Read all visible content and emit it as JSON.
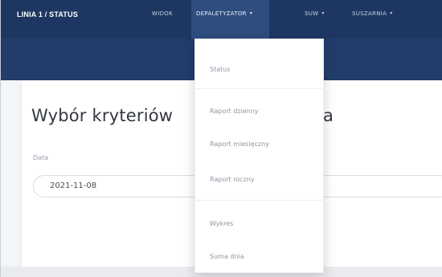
{
  "navbar": {
    "brand": "LINIA 1 / STATUS",
    "items": [
      {
        "label": "WIDOK",
        "caret": ""
      },
      {
        "label": "DEPALETYZATOR",
        "caret": "▾"
      },
      {
        "label": "SUW",
        "caret": "▾"
      },
      {
        "label": "SUSZARNIA",
        "caret": "▾"
      }
    ]
  },
  "dropdown": {
    "items": [
      "Status",
      "Raport dzienny",
      "Raport miesięczny",
      "Raport roczny",
      "Wykres",
      "Suma dnia"
    ]
  },
  "card": {
    "title": "Wybór kryteriów",
    "title_tail": "a",
    "date_label": "Data",
    "date_value": "2021-11-08"
  },
  "colors": {
    "navbar": "#1e3762",
    "band": "#223d6b",
    "active_nav": "#2f4d7e"
  }
}
